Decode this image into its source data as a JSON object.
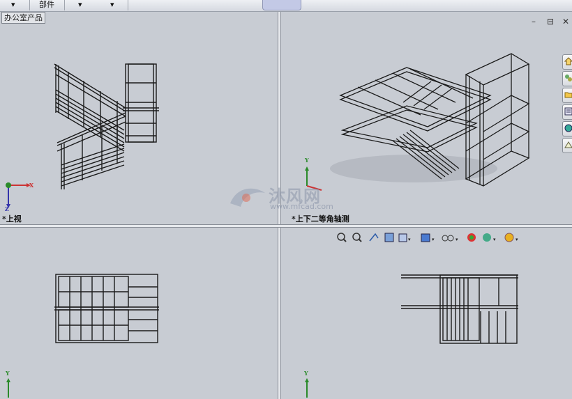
{
  "toolbar": {
    "items": [
      "▾",
      "部件",
      "▾",
      "▾"
    ]
  },
  "tree_tag": "办公室产品",
  "views": {
    "top_left": "*上视",
    "top_right": "*上下二等角轴测"
  },
  "triad": {
    "x": "X",
    "y": "Y",
    "z": "Z"
  },
  "watermark": {
    "title": "沐风网",
    "subtitle": "www.mfcad.com"
  },
  "window_controls": {
    "minimize": "–",
    "restore": "⊟",
    "close": "✕"
  },
  "side_tabs": [
    "home-icon",
    "parts-icon",
    "folder-icon",
    "properties-icon",
    "appearance-icon",
    "custom-icon"
  ],
  "view_toolbar": [
    "zoom-fit-icon",
    "zoom-area-icon",
    "previous-view-icon",
    "section-view-icon",
    "view-orientation-icon",
    "display-style-icon",
    "hide-show-icon",
    "edit-appearance-icon",
    "apply-scene-icon",
    "view-settings-icon"
  ]
}
